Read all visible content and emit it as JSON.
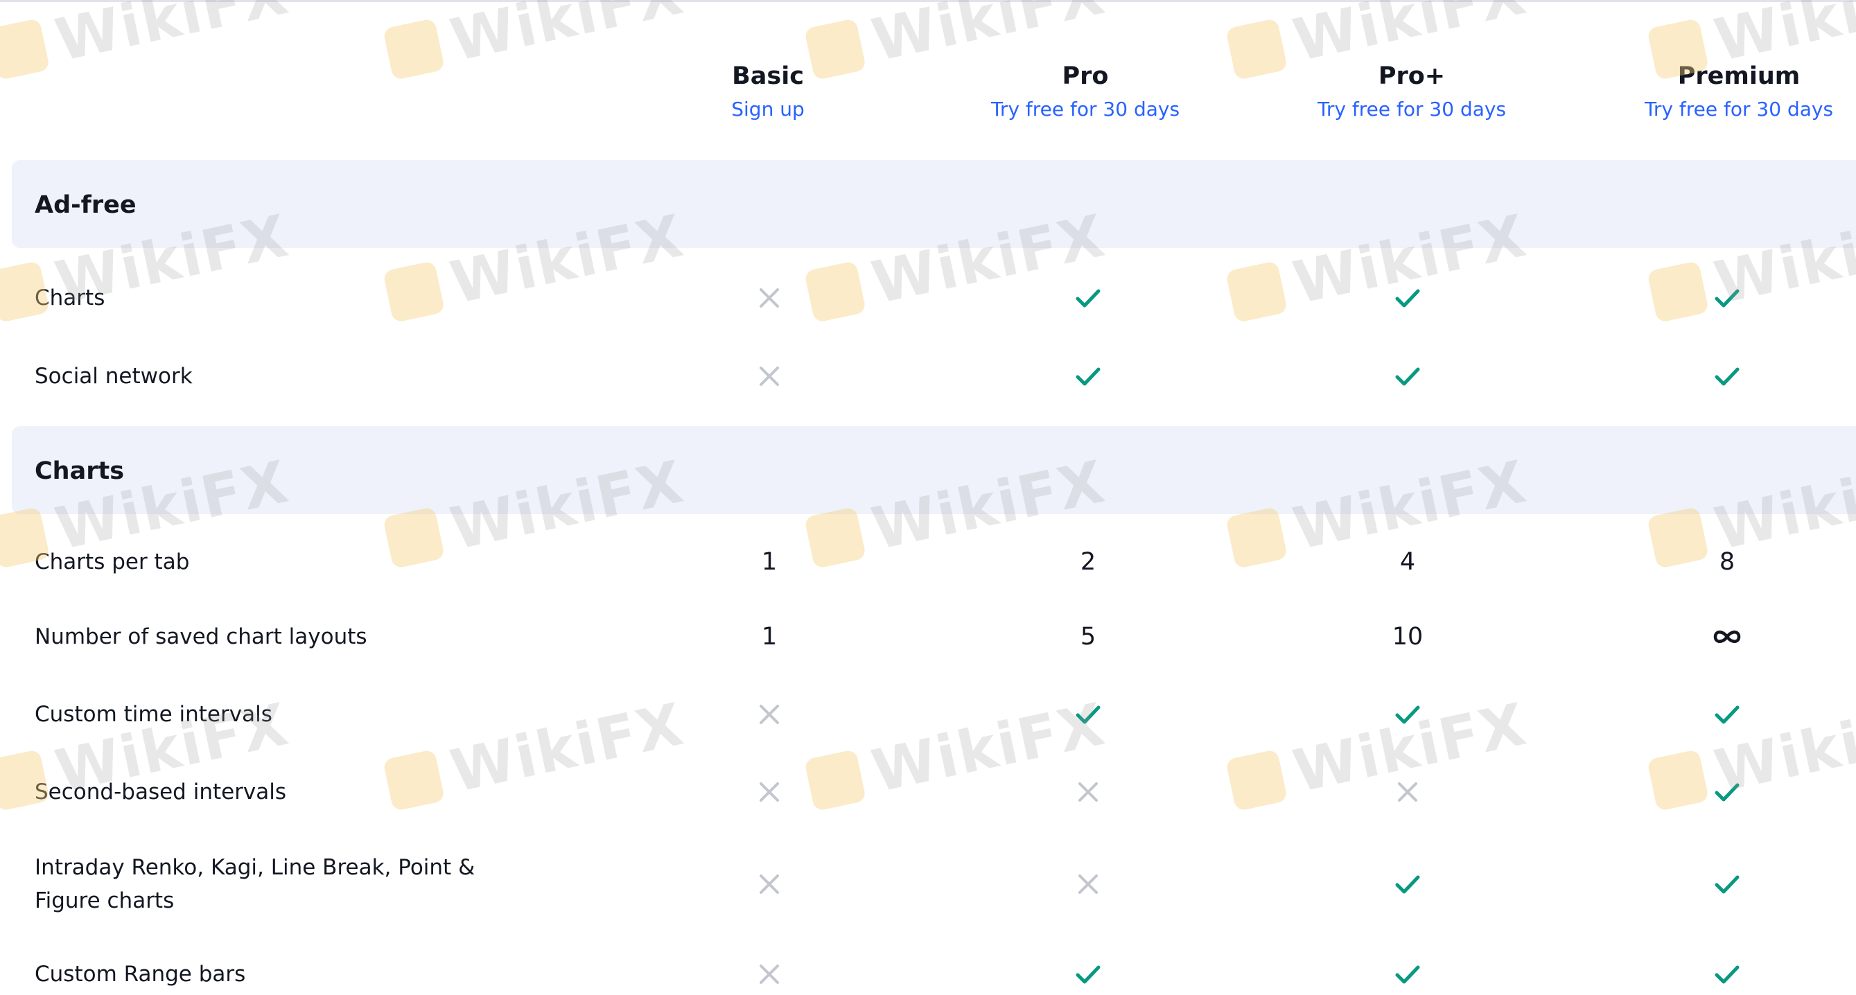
{
  "plans": [
    {
      "name": "Basic",
      "link": "Sign up"
    },
    {
      "name": "Pro",
      "link": "Try free for 30 days"
    },
    {
      "name": "Pro+",
      "link": "Try free for 30 days"
    },
    {
      "name": "Premium",
      "link": "Try free for 30 days"
    }
  ],
  "watermark": {
    "text": "WikiFX"
  },
  "colors": {
    "check": "#089981",
    "cross": "#c3c6ce",
    "link": "#2962ff",
    "section_bg": "#eff2fa"
  },
  "sections": [
    {
      "title": "Ad-free",
      "rows": [
        {
          "label": "Charts",
          "values": [
            "cross-icon",
            "check-icon",
            "check-icon",
            "check-icon"
          ]
        },
        {
          "label": "Social network",
          "values": [
            "cross-icon",
            "check-icon",
            "check-icon",
            "check-icon"
          ]
        }
      ]
    },
    {
      "title": "Charts",
      "rows": [
        {
          "label": "Charts per tab",
          "values": [
            "1",
            "2",
            "4",
            "8"
          ]
        },
        {
          "label": "Number of saved chart layouts",
          "values": [
            "1",
            "5",
            "10",
            "infinity-icon"
          ]
        },
        {
          "label": "Custom time intervals",
          "values": [
            "cross-icon",
            "check-icon",
            "check-icon",
            "check-icon"
          ]
        },
        {
          "label": "Second-based intervals",
          "values": [
            "cross-icon",
            "cross-icon",
            "cross-icon",
            "check-icon"
          ]
        },
        {
          "label": "Intraday Renko, Kagi, Line Break, Point & Figure charts",
          "values": [
            "cross-icon",
            "cross-icon",
            "check-icon",
            "check-icon"
          ]
        },
        {
          "label": "Custom Range bars",
          "values": [
            "cross-icon",
            "check-icon",
            "check-icon",
            "check-icon"
          ]
        }
      ]
    }
  ]
}
